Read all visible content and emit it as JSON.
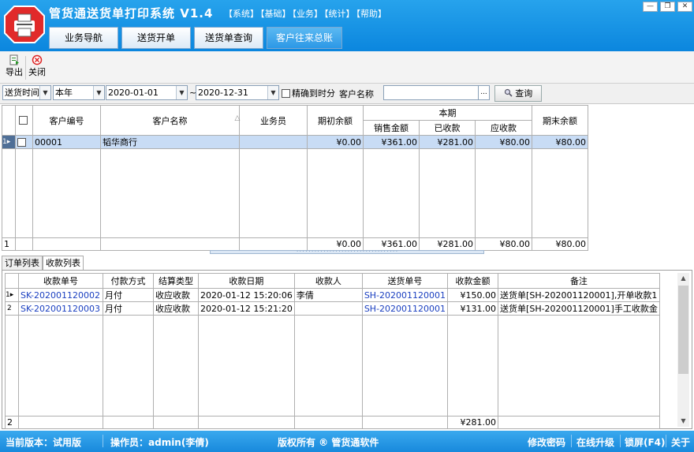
{
  "app": {
    "title": "管货通送货单打印系统 V1.4",
    "menu": [
      "【系统】",
      "【基础】",
      "【业务】",
      "【统计】",
      "【帮助】"
    ],
    "window_buttons": [
      "—",
      "❐",
      "✕"
    ]
  },
  "nav_tabs": [
    "业务导航",
    "送货开单",
    "送货单查询",
    "客户往来总账"
  ],
  "toolbar": {
    "export_label": "导出",
    "close_label": "关闭"
  },
  "filter": {
    "field": "送货时间",
    "period": "本年",
    "date_from": "2020-01-01",
    "tilde": "~",
    "date_to": "2020-12-31",
    "precise_label": "精确到时分",
    "customer_label": "客户名称",
    "customer_value": "",
    "ellipsis": "...",
    "query_label": "查询"
  },
  "main_grid": {
    "headers": {
      "code": "客户编号",
      "name": "客户名称",
      "sort_mark": "△",
      "clerk": "业务员",
      "opening": "期初余额",
      "period_group": "本期",
      "sales": "销售金额",
      "received": "已收款",
      "receivable": "应收款",
      "closing": "期末余额"
    },
    "rows": [
      {
        "idx": "1",
        "code": "00001",
        "name": "韬华商行",
        "clerk": "",
        "opening": "¥0.00",
        "sales": "¥361.00",
        "received": "¥281.00",
        "receivable": "¥80.00",
        "closing": "¥80.00"
      }
    ],
    "footer": {
      "count": "1",
      "opening": "¥0.00",
      "sales": "¥361.00",
      "received": "¥281.00",
      "receivable": "¥80.00",
      "closing": "¥80.00"
    }
  },
  "sub_tabs": [
    "订单列表",
    "收款列表"
  ],
  "pay_grid": {
    "headers": {
      "pay_no": "收款单号",
      "method": "付款方式",
      "settle": "结算类型",
      "date": "收款日期",
      "payee": "收款人",
      "order_no": "送货单号",
      "amount": "收款金额",
      "note": "备注"
    },
    "rows": [
      {
        "idx": "1",
        "pay_no": "SK-202001120002",
        "method": "月付",
        "settle": "收应收款",
        "date": "2020-01-12 15:20:06",
        "payee": "李倩",
        "order_no": "SH-202001120001",
        "amount": "¥150.00",
        "note": "送货单[SH-202001120001],开单收款1"
      },
      {
        "idx": "2",
        "pay_no": "SK-202001120003",
        "method": "月付",
        "settle": "收应收款",
        "date": "2020-01-12 15:21:20",
        "payee": "",
        "order_no": "SH-202001120001",
        "amount": "¥131.00",
        "note": "送货单[SH-202001120001]手工收款金"
      }
    ],
    "footer": {
      "count": "2",
      "amount": "¥281.00"
    }
  },
  "status": {
    "version": "当前版本：试用版",
    "operator": "操作员：admin(李倩)",
    "copyright": "版权所有 ® 管货通软件",
    "change_pwd": "修改密码",
    "upgrade": "在线升级",
    "lock": "锁屏(F4)",
    "about": "关于"
  }
}
